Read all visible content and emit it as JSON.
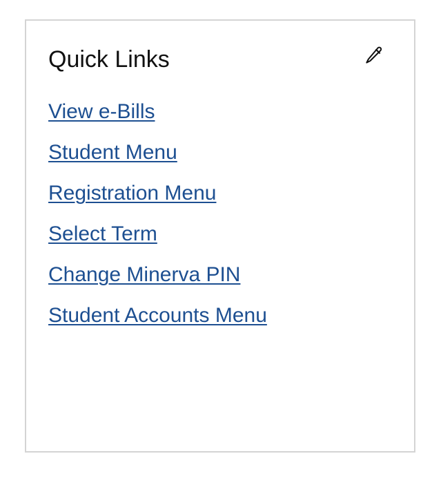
{
  "card": {
    "title": "Quick Links",
    "edit_icon": "pencil-icon",
    "links": [
      {
        "label": "View e-Bills"
      },
      {
        "label": "Student Menu"
      },
      {
        "label": "Registration Menu"
      },
      {
        "label": "Select Term"
      },
      {
        "label": "Change Minerva PIN"
      },
      {
        "label": "Student Accounts Menu"
      }
    ]
  },
  "colors": {
    "link": "#1d4f91",
    "border": "#d4d4d4",
    "title": "#111111"
  }
}
